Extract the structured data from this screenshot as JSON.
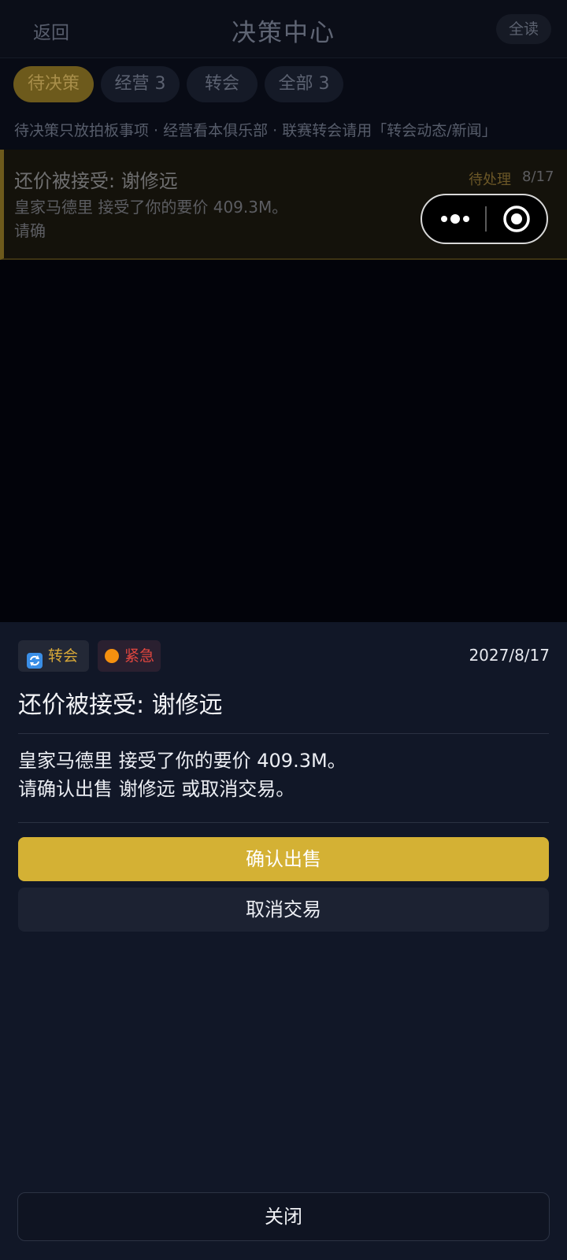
{
  "header": {
    "back_label": "返回",
    "title": "决策中心",
    "read_all_label": "全读"
  },
  "tabs": [
    {
      "label": "待决策",
      "active": true
    },
    {
      "label": "经营 3",
      "active": false
    },
    {
      "label": "转会",
      "active": false
    },
    {
      "label": "全部 3",
      "active": false
    }
  ],
  "hint": "待决策只放拍板事项 · 经营看本俱乐部 · 联赛转会请用「转会动态/新闻」",
  "card": {
    "title": "还价被接受: 谢修远",
    "status": "待处理",
    "date": "8/17",
    "body_line1": "皇家马德里 接受了你的要价 409.3M。",
    "body_line2": "请确"
  },
  "capsule": {
    "more_icon": "more-dots-icon",
    "close_icon": "target-close-icon"
  },
  "sheet": {
    "tag_category": "转会",
    "tag_category_icon": "refresh-icon",
    "tag_priority": "紧急",
    "tag_priority_icon": "orange-dot-icon",
    "date": "2027/8/17",
    "title": "还价被接受: 谢修远",
    "body_line1": "皇家马德里 接受了你的要价 409.3M。",
    "body_line2": "请确认出售 谢修远 或取消交易。",
    "confirm_label": "确认出售",
    "cancel_label": "取消交易",
    "close_label": "关闭"
  },
  "colors": {
    "accent_gold": "#d4b134",
    "urgent_red": "#e0463f",
    "urgent_dot": "#f5900f",
    "sheet_bg": "#111727"
  }
}
